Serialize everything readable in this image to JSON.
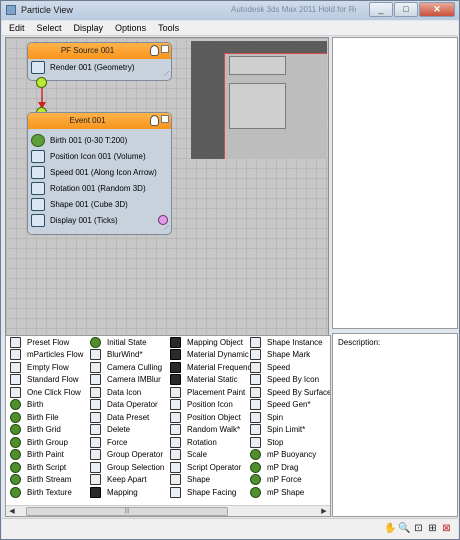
{
  "window": {
    "title": "Particle View",
    "ghost_title": "Autodesk 3ds Max 2011  Hold for Render  _pview_scene"
  },
  "menu": [
    "Edit",
    "Select",
    "Display",
    "Options",
    "Tools"
  ],
  "pf_source": {
    "title": "PF Source 001",
    "operator": "Render 001 (Geometry)"
  },
  "event": {
    "title": "Event 001",
    "operators": [
      "Birth 001 (0-30 T:200)",
      "Position Icon 001 (Volume)",
      "Speed 001 (Along Icon Arrow)",
      "Rotation 001 (Random 3D)",
      "Shape 001 (Cube 3D)",
      "Display 001 (Ticks)"
    ]
  },
  "depot": {
    "columns": [
      [
        "Preset Flow",
        "mParticles Flow",
        "Empty Flow",
        "Standard Flow",
        "One Click Flow",
        "Birth",
        "Birth File",
        "Birth Grid",
        "Birth Group",
        "Birth Paint",
        "Birth Script",
        "Birth Stream",
        "Birth Texture"
      ],
      [
        "Initial State",
        "BlurWind*",
        "Camera Culling",
        "Camera IMBlur",
        "Data Icon",
        "Data Operator",
        "Data Preset",
        "Delete",
        "Force",
        "Group Operator",
        "Group Selection",
        "Keep Apart",
        "Mapping"
      ],
      [
        "Mapping Object",
        "Material Dynamic",
        "Material Frequency",
        "Material Static",
        "Placement Paint",
        "Position Icon",
        "Position Object",
        "Random Walk*",
        "Rotation",
        "Scale",
        "Script Operator",
        "Shape",
        "Shape Facing"
      ],
      [
        "Shape Instance",
        "Shape Mark",
        "Speed",
        "Speed By Icon",
        "Speed By Surface",
        "Speed Gen*",
        "Spin",
        "Spin Limit*",
        "Stop",
        "mP Buoyancy",
        "mP Drag",
        "mP Force",
        "mP Shape"
      ]
    ]
  },
  "description": {
    "label": "Description:"
  },
  "status_tools": [
    "pan-icon",
    "zoom-icon",
    "zoom-region-icon",
    "zoom-extents-icon",
    "no-draw-icon"
  ],
  "colors": {
    "event_header": "#f7941d",
    "node_body": "#c8d2dc",
    "pin": "#b9ea38",
    "wire": "#cc1f1f",
    "display_swatch": "#e39be8"
  }
}
